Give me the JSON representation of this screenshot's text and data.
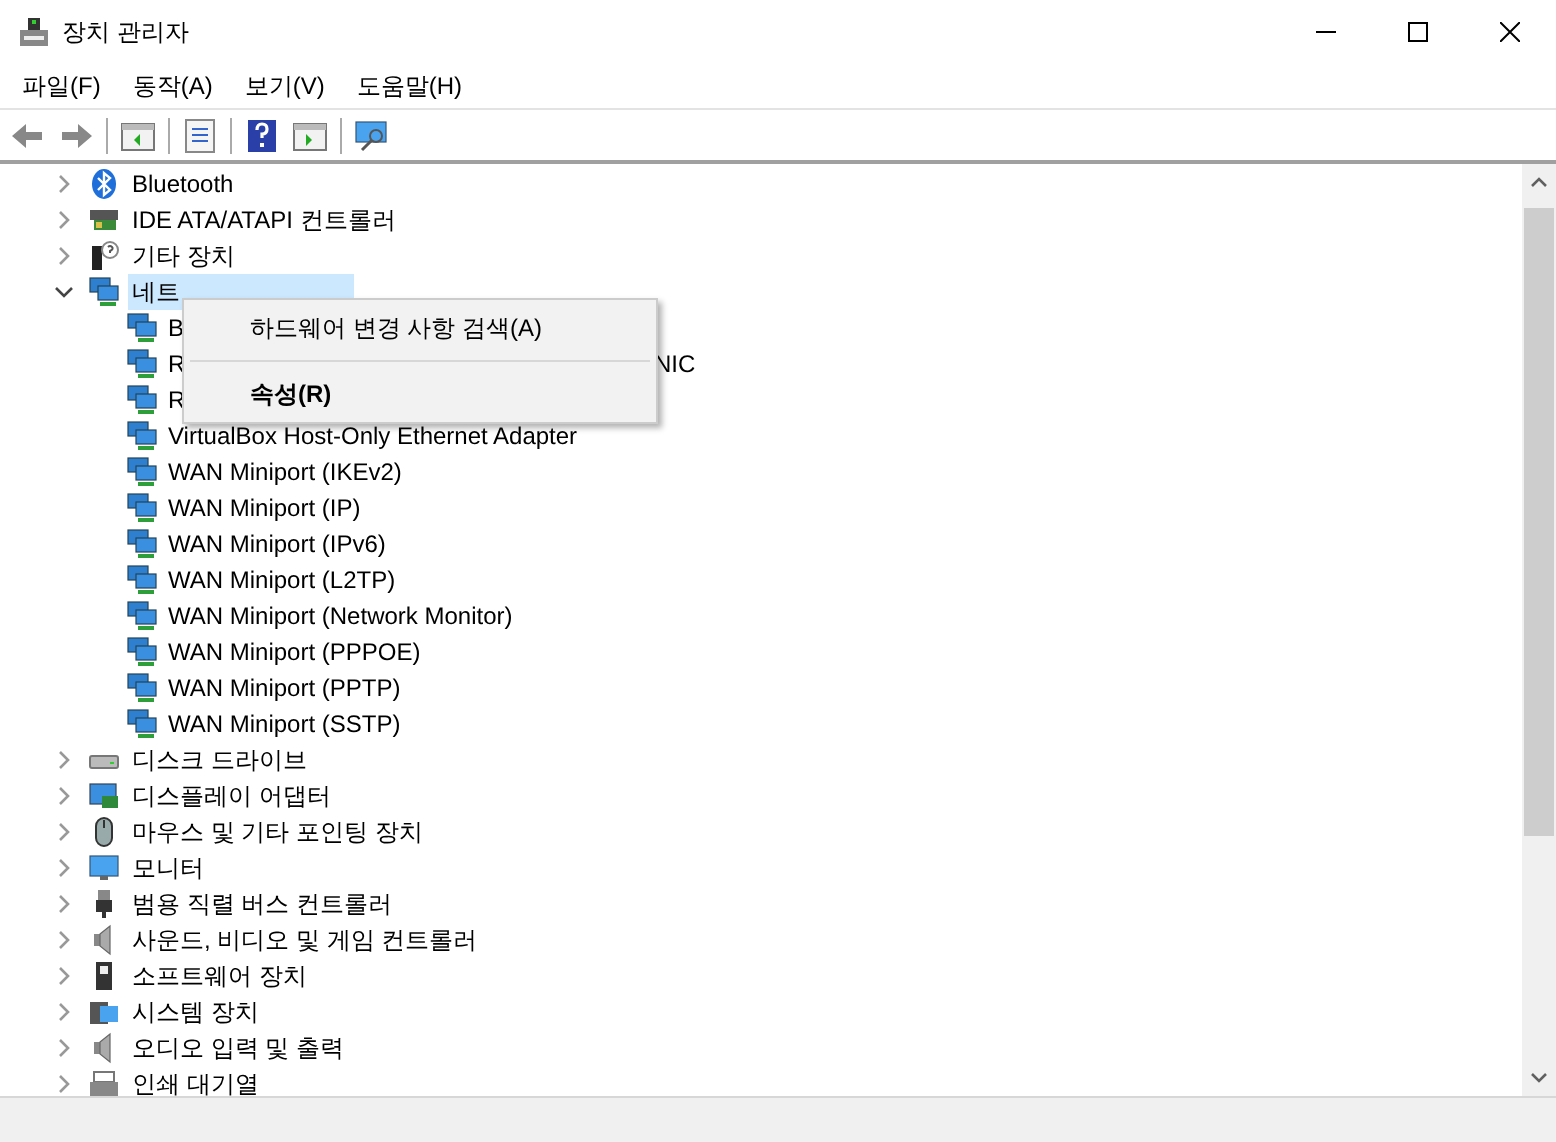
{
  "window": {
    "title": "장치 관리자"
  },
  "menu": [
    "파일(F)",
    "동작(A)",
    "보기(V)",
    "도움말(H)"
  ],
  "tree": [
    {
      "label": "Bluetooth",
      "kind": "bluetooth",
      "expanded": false,
      "selected": false
    },
    {
      "label": "IDE ATA/ATAPI 컨트롤러",
      "kind": "ide",
      "expanded": false,
      "selected": false
    },
    {
      "label": "기타 장치",
      "kind": "other",
      "expanded": false,
      "selected": false
    },
    {
      "label": "네트",
      "kind": "network",
      "expanded": true,
      "selected": true,
      "children": [
        {
          "label": "B",
          "kind": "network"
        },
        {
          "label": "R",
          "tail": "NIC",
          "kind": "network"
        },
        {
          "label": "R",
          "kind": "network"
        },
        {
          "label": "VirtualBox Host-Only Ethernet Adapter",
          "kind": "network"
        },
        {
          "label": "WAN Miniport (IKEv2)",
          "kind": "network"
        },
        {
          "label": "WAN Miniport (IP)",
          "kind": "network"
        },
        {
          "label": "WAN Miniport (IPv6)",
          "kind": "network"
        },
        {
          "label": "WAN Miniport (L2TP)",
          "kind": "network"
        },
        {
          "label": "WAN Miniport (Network Monitor)",
          "kind": "network"
        },
        {
          "label": "WAN Miniport (PPPOE)",
          "kind": "network"
        },
        {
          "label": "WAN Miniport (PPTP)",
          "kind": "network"
        },
        {
          "label": "WAN Miniport (SSTP)",
          "kind": "network"
        }
      ]
    },
    {
      "label": "디스크 드라이브",
      "kind": "disk",
      "expanded": false,
      "selected": false
    },
    {
      "label": "디스플레이 어댑터",
      "kind": "display",
      "expanded": false,
      "selected": false
    },
    {
      "label": "마우스 및 기타 포인팅 장치",
      "kind": "mouse",
      "expanded": false,
      "selected": false
    },
    {
      "label": "모니터",
      "kind": "monitor",
      "expanded": false,
      "selected": false
    },
    {
      "label": "범용 직렬 버스 컨트롤러",
      "kind": "usb",
      "expanded": false,
      "selected": false
    },
    {
      "label": "사운드, 비디오 및 게임 컨트롤러",
      "kind": "sound",
      "expanded": false,
      "selected": false
    },
    {
      "label": "소프트웨어 장치",
      "kind": "software",
      "expanded": false,
      "selected": false
    },
    {
      "label": "시스템 장치",
      "kind": "system",
      "expanded": false,
      "selected": false
    },
    {
      "label": "오디오 입력 및 출력",
      "kind": "sound",
      "expanded": false,
      "selected": false
    },
    {
      "label": "인쇄 대기열",
      "kind": "printer",
      "expanded": false,
      "selected": false
    }
  ],
  "context_menu": [
    {
      "label": "하드웨어 변경 사항 검색(A)",
      "bold": false
    },
    {
      "label": "속성(R)",
      "bold": true
    }
  ]
}
